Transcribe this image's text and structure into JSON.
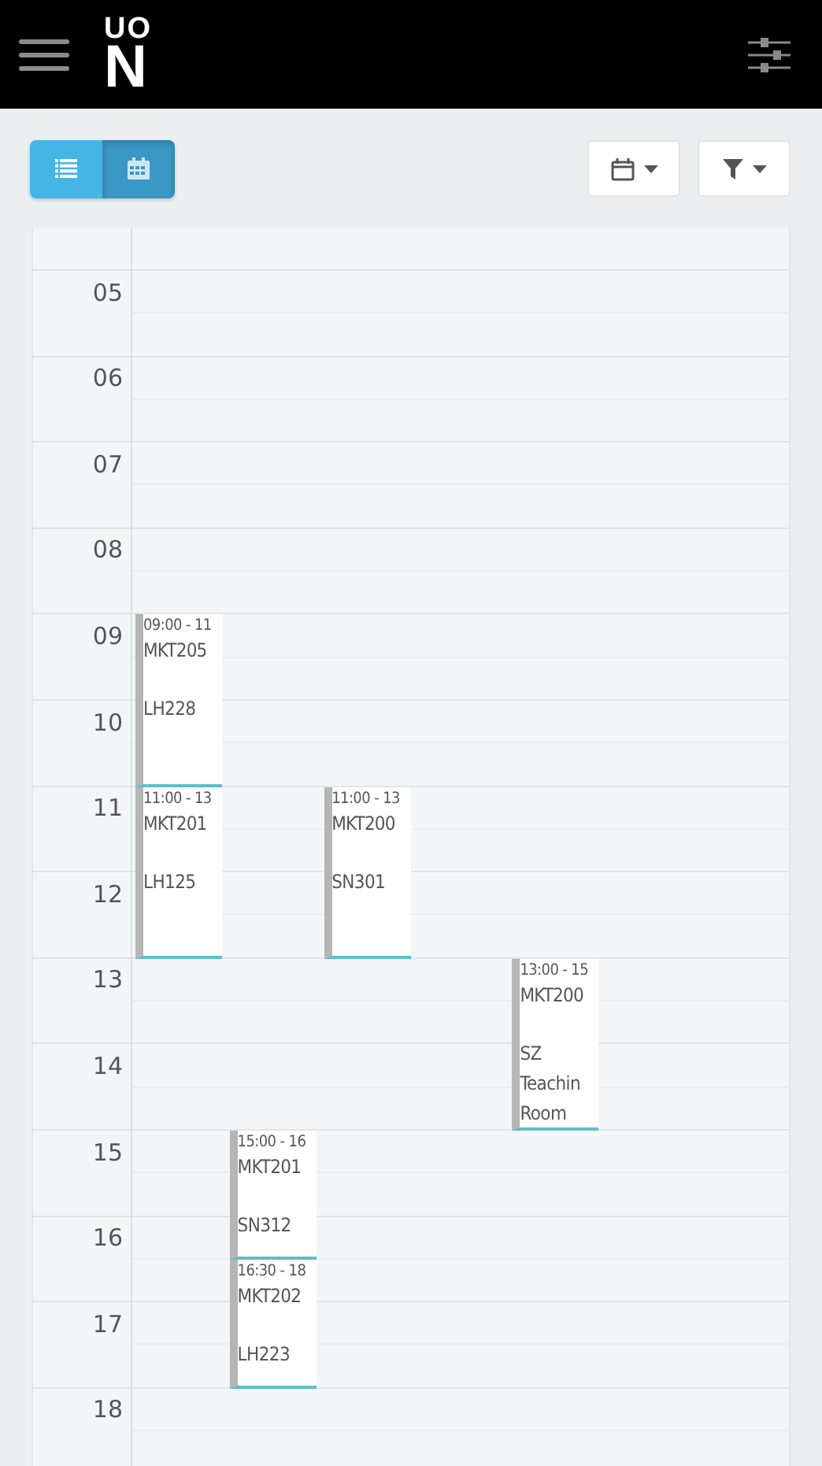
{
  "header": {
    "logo": {
      "top": "UO",
      "bottom": "N"
    }
  },
  "toolbar": {
    "views": [
      {
        "kind": "list",
        "selected": false
      },
      {
        "kind": "calendar",
        "selected": true
      }
    ],
    "dropdowns": [
      {
        "kind": "date"
      },
      {
        "kind": "filter"
      }
    ]
  },
  "timetable": {
    "hours": [
      "05",
      "06",
      "07",
      "08",
      "09",
      "10",
      "11",
      "12",
      "13",
      "14",
      "15",
      "16",
      "17",
      "18"
    ],
    "events": [
      {
        "time": "09:00 - 11",
        "code": "MKT205",
        "room": "LH228"
      },
      {
        "time": "11:00 - 13",
        "code": "MKT201",
        "room": "LH125"
      },
      {
        "time": "11:00 - 13",
        "code": "MKT200",
        "room": "SN301"
      },
      {
        "time": "13:00 - 15",
        "code": "MKT200",
        "room": "SZ Teachin Room"
      },
      {
        "time": "15:00 - 16",
        "code": "MKT201",
        "room": "SN312"
      },
      {
        "time": "16:30 - 18",
        "code": "MKT202",
        "room": "LH223"
      }
    ]
  }
}
